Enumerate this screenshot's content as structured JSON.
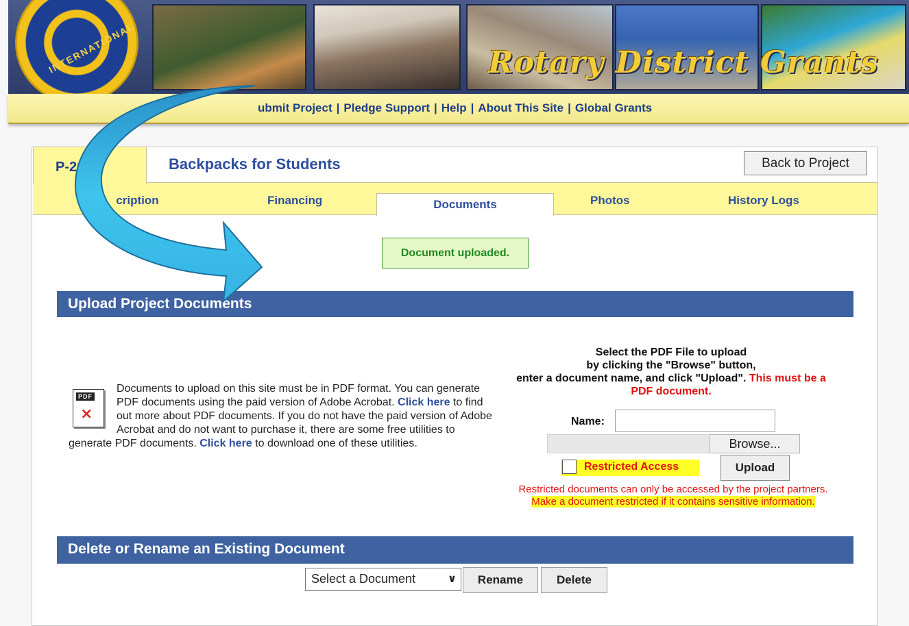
{
  "banner": {
    "title": "Rotary District Grants",
    "emblem_text": "INTERNATIONAL"
  },
  "nav": {
    "items": [
      "ubmit Project",
      "Pledge Support",
      "Help",
      "About This Site",
      "Global Grants"
    ],
    "separator": "|"
  },
  "project": {
    "id": "P-202",
    "title": "Backpacks for Students",
    "back_label": "Back to Project"
  },
  "tabs": {
    "description": "D",
    "description_rest": "cription",
    "financing": "Financing",
    "documents": "Documents",
    "photos": "Photos",
    "history": "History Logs"
  },
  "flash": "Document uploaded.",
  "upload_section": {
    "heading": "Upload Project Documents",
    "pdf_icon_label": "PDF",
    "info_part1": "Documents to upload on this site must be in PDF format. You can generate PDF documents using the paid version of Adobe Acrobat.",
    "link1": "Click here",
    "info_part2": "to find out more about PDF documents. If you do not have the paid version of Adobe Acrobat and do not want to purchase it, there are some free utilities to generate PDF documents.",
    "link2": "Click here",
    "info_part3": "to download one of these utilities.",
    "instr_line1": "Select the PDF File to upload",
    "instr_line2": "by clicking the \"Browse\" button,",
    "instr_line3": "enter a document name, and click \"Upload\".",
    "instr_warn": "This must be a PDF document.",
    "name_label": "Name:",
    "name_value": "",
    "browse_label": "Browse...",
    "restricted_label": "Restricted Access",
    "upload_label": "Upload",
    "restrict_note": "Restricted documents can only be accessed by the project partners.",
    "restrict_note_hl": "Make a document restricted if it contains sensitive information."
  },
  "delete_section": {
    "heading": "Delete or Rename an Existing Document",
    "select_value": "Select a Document",
    "rename_label": "Rename",
    "delete_label": "Delete"
  },
  "colors": {
    "nav_bg": "#fdf6b2",
    "tab_bg": "#fef89a",
    "section_bg": "#3f62a0",
    "link": "#2e4f9e",
    "warning": "#e01212",
    "highlight": "#ffff28",
    "success": "#1f8a1f",
    "arrow": "#3ec4ee"
  }
}
